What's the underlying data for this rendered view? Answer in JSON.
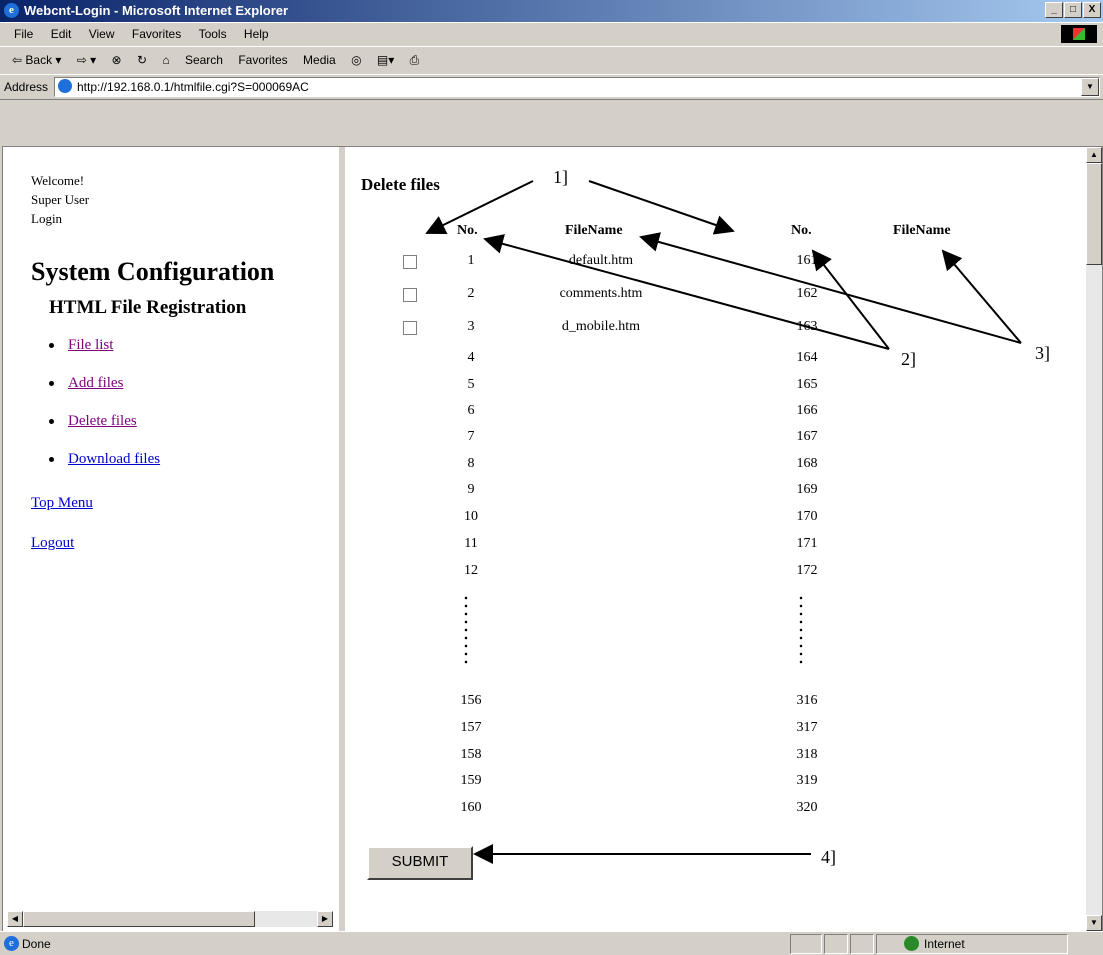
{
  "window": {
    "title": "Webcnt-Login - Microsoft Internet Explorer",
    "minimize": "_",
    "maximize": "□",
    "close": "X"
  },
  "menu": [
    "File",
    "Edit",
    "View",
    "Favorites",
    "Tools",
    "Help"
  ],
  "toolbar": [
    "⇦ Back ▾",
    "⇨ ▾",
    "⊗",
    "↻",
    "⌂",
    "Search",
    "Favorites",
    "Media",
    "◎",
    "▤▾",
    "⎙"
  ],
  "address": {
    "label": "Address",
    "url": "http://192.168.0.1/htmlfile.cgi?S=000069AC"
  },
  "left": {
    "welcome": "Welcome!",
    "user": "Super User",
    "login": "Login",
    "system_configuration": "System Configuration",
    "html_registration": "HTML File Registration",
    "nav": [
      "File list",
      "Add files",
      "Delete files",
      "Download files"
    ],
    "top_menu": "Top Menu",
    "logout": "Logout"
  },
  "main": {
    "title": "Delete files",
    "headers": {
      "no": "No.",
      "filename": "FileName"
    },
    "rows": [
      {
        "n1": "1",
        "file": "default.htm",
        "n2": "161",
        "checkbox": true
      },
      {
        "n1": "2",
        "file": "comments.htm",
        "n2": "162",
        "checkbox": true
      },
      {
        "n1": "3",
        "file": "d_mobile.htm",
        "n2": "163",
        "checkbox": true
      },
      {
        "n1": "4",
        "file": "",
        "n2": "164"
      },
      {
        "n1": "5",
        "file": "",
        "n2": "165"
      },
      {
        "n1": "6",
        "file": "",
        "n2": "166"
      },
      {
        "n1": "7",
        "file": "",
        "n2": "167"
      },
      {
        "n1": "8",
        "file": "",
        "n2": "168"
      },
      {
        "n1": "9",
        "file": "",
        "n2": "169"
      },
      {
        "n1": "10",
        "file": "",
        "n2": "170"
      },
      {
        "n1": "11",
        "file": "",
        "n2": "171"
      },
      {
        "n1": "12",
        "file": "",
        "n2": "172"
      }
    ],
    "rows_bottom": [
      {
        "n1": "156",
        "n2": "316"
      },
      {
        "n1": "157",
        "n2": "317"
      },
      {
        "n1": "158",
        "n2": "318"
      },
      {
        "n1": "159",
        "n2": "319"
      },
      {
        "n1": "160",
        "n2": "320"
      }
    ],
    "submit": "SUBMIT"
  },
  "callouts": [
    "1]",
    "2]",
    "3]",
    "4]"
  ],
  "status": {
    "left": "Done",
    "zone": "Internet"
  }
}
